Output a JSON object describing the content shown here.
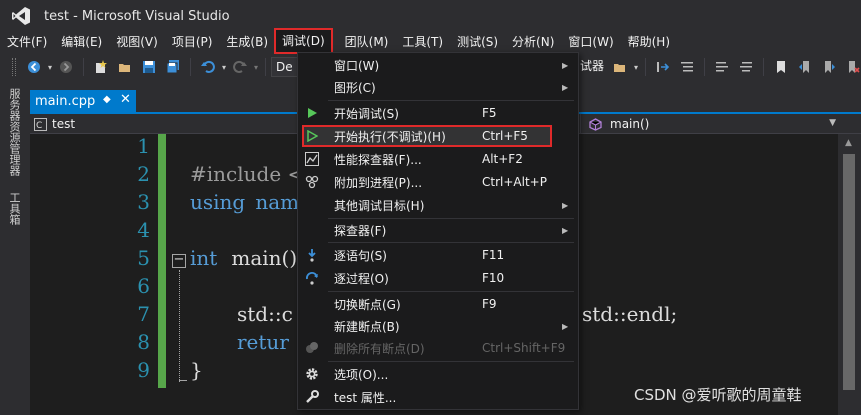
{
  "window": {
    "title": "test - Microsoft Visual Studio"
  },
  "menubar": {
    "items": [
      "文件(F)",
      "编辑(E)",
      "视图(V)",
      "项目(P)",
      "生成(B)",
      "调试(D)",
      "团队(M)",
      "工具(T)",
      "测试(S)",
      "分析(N)",
      "窗口(W)",
      "帮助(H)"
    ]
  },
  "toolbar": {
    "config_combo": "De",
    "right_combo": "试器"
  },
  "side_tabs": {
    "server_explorer": "服务器资源管理器",
    "toolbox": "工具箱"
  },
  "document": {
    "tab_label": "main.cpp",
    "pin_glyph": "◆",
    "close_glyph": "✕"
  },
  "navbar": {
    "scope": "test",
    "member": "main()"
  },
  "editor": {
    "line_numbers": [
      "1",
      "2",
      "3",
      "4",
      "5",
      "6",
      "7",
      "8",
      "9"
    ],
    "line2": "#include <",
    "line3_kw": "using",
    "line3_rest": " name",
    "line5_kw": "int",
    "line5_rest": " main()",
    "line7_left": "std::c",
    "line7_right": "std::endl;",
    "line8_kw": "retur",
    "line9": "}"
  },
  "debug_menu": {
    "items": [
      {
        "label": "窗口(W)",
        "shortcut": "",
        "submenu": true
      },
      {
        "label": "图形(C)",
        "shortcut": "",
        "submenu": true
      },
      {
        "label": "开始调试(S)",
        "shortcut": "F5",
        "submenu": false
      },
      {
        "label": "开始执行(不调试)(H)",
        "shortcut": "Ctrl+F5",
        "submenu": false
      },
      {
        "label": "性能探查器(F)...",
        "shortcut": "Alt+F2",
        "submenu": false
      },
      {
        "label": "附加到进程(P)...",
        "shortcut": "Ctrl+Alt+P",
        "submenu": false
      },
      {
        "label": "其他调试目标(H)",
        "shortcut": "",
        "submenu": true
      },
      {
        "label": "探查器(F)",
        "shortcut": "",
        "submenu": true
      },
      {
        "label": "逐语句(S)",
        "shortcut": "F11",
        "submenu": false
      },
      {
        "label": "逐过程(O)",
        "shortcut": "F10",
        "submenu": false
      },
      {
        "label": "切换断点(G)",
        "shortcut": "F9",
        "submenu": false
      },
      {
        "label": "新建断点(B)",
        "shortcut": "",
        "submenu": true
      },
      {
        "label": "删除所有断点(D)",
        "shortcut": "Ctrl+Shift+F9",
        "submenu": false
      },
      {
        "label": "选项(O)...",
        "shortcut": "",
        "submenu": false
      },
      {
        "label": "test 属性...",
        "shortcut": "",
        "submenu": false
      }
    ]
  },
  "watermark": "CSDN @爱听歌的周童鞋",
  "colors": {
    "accent": "#007acc",
    "highlight_box": "#e02a2a",
    "line_number": "#2b91af",
    "keyword": "#569cd6",
    "change_bar": "#57a64a"
  }
}
